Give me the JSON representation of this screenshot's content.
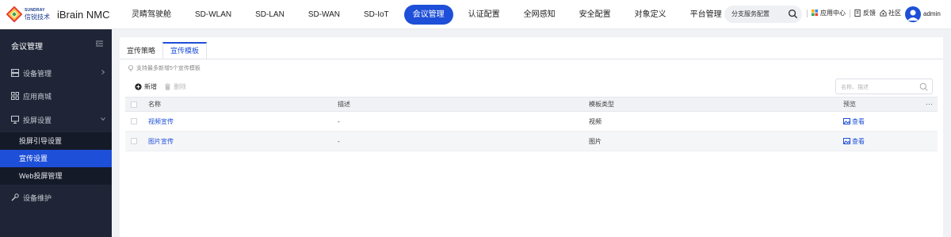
{
  "brand": {
    "logo_en": "SUNDRAY",
    "logo_cn": "信锐技术",
    "product": "iBrain NMC"
  },
  "nav": [
    {
      "label": "灵睛驾驶舱",
      "active": false
    },
    {
      "label": "SD-WLAN",
      "active": false
    },
    {
      "label": "SD-LAN",
      "active": false
    },
    {
      "label": "SD-WAN",
      "active": false
    },
    {
      "label": "SD-IoT",
      "active": false
    },
    {
      "label": "会议管理",
      "active": true
    },
    {
      "label": "认证配置",
      "active": false
    },
    {
      "label": "全网感知",
      "active": false
    },
    {
      "label": "安全配置",
      "active": false
    },
    {
      "label": "对象定义",
      "active": false
    },
    {
      "label": "平台管理",
      "active": false
    }
  ],
  "top_search": {
    "value": "分支服务配置"
  },
  "tools": {
    "app_center": "应用中心",
    "feedback": "反馈",
    "community": "社区",
    "user": "admin"
  },
  "sidebar": {
    "title": "会议管理",
    "items": [
      {
        "label": "设备管理",
        "icon": "server-icon"
      },
      {
        "label": "应用商城",
        "icon": "grid-icon"
      },
      {
        "label": "投屏设置",
        "icon": "monitor-icon"
      },
      {
        "label": "设备维护",
        "icon": "wrench-icon"
      }
    ],
    "subitems": [
      {
        "label": "投屏引导设置",
        "active": false
      },
      {
        "label": "宣传设置",
        "active": true
      },
      {
        "label": "Web投屏管理",
        "active": false
      }
    ]
  },
  "tabs": [
    {
      "label": "宣传策略",
      "active": false
    },
    {
      "label": "宣传模板",
      "active": true
    }
  ],
  "hint": "支持最多新增5个宣传模板",
  "toolbar": {
    "add": "新增",
    "delete": "删除"
  },
  "table_search": {
    "placeholder": "名称、描述"
  },
  "table": {
    "headers": {
      "name": "名称",
      "desc": "描述",
      "type": "模板类型",
      "preview": "预览"
    },
    "more": "···",
    "rows": [
      {
        "name": "视频宣传",
        "desc": "-",
        "type": "视频",
        "preview": "查看"
      },
      {
        "name": "图片宣传",
        "desc": "-",
        "type": "图片",
        "preview": "查看"
      }
    ]
  },
  "colors": {
    "accent": "#1e4fd8",
    "sidebar_bg": "#1f2536"
  }
}
